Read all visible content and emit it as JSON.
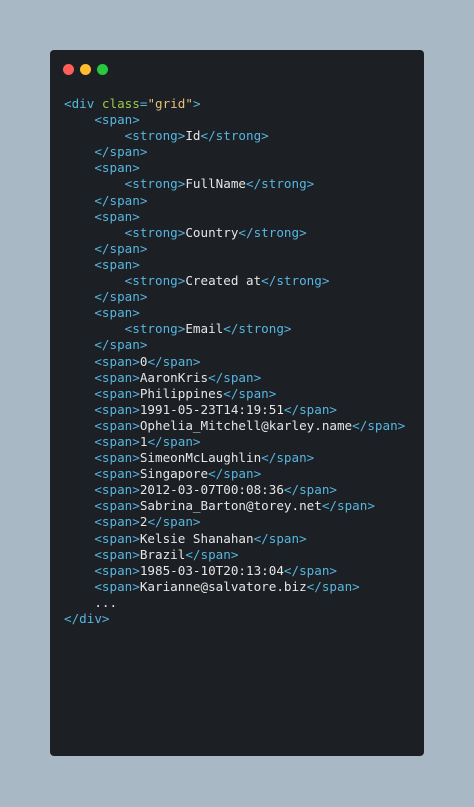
{
  "window": {
    "controls": [
      "close",
      "minimize",
      "maximize"
    ],
    "colors": {
      "close": "#ff5f56",
      "minimize": "#ffbd2e",
      "maximize": "#27c93f",
      "background": "#1c1f23",
      "page": "#a9b8c5"
    }
  },
  "code": {
    "tag_color": "#56b6e0",
    "attr_color": "#9ec74a",
    "string_color": "#e5c07b",
    "text_color": "#e6e6e6",
    "lines": [
      {
        "indent": 0,
        "parts": [
          [
            "tag",
            "<div "
          ],
          [
            "attr",
            "class"
          ],
          [
            "tag",
            "="
          ],
          [
            "str",
            "\"grid\""
          ],
          [
            "tag",
            ">"
          ]
        ]
      },
      {
        "indent": 1,
        "parts": [
          [
            "tag",
            "<span>"
          ]
        ]
      },
      {
        "indent": 2,
        "parts": [
          [
            "tag",
            "<strong>"
          ],
          [
            "txt",
            "Id"
          ],
          [
            "tag",
            "</strong>"
          ]
        ]
      },
      {
        "indent": 1,
        "parts": [
          [
            "tag",
            "</span>"
          ]
        ]
      },
      {
        "indent": 1,
        "parts": [
          [
            "tag",
            "<span>"
          ]
        ]
      },
      {
        "indent": 2,
        "parts": [
          [
            "tag",
            "<strong>"
          ],
          [
            "txt",
            "FullName"
          ],
          [
            "tag",
            "</strong>"
          ]
        ]
      },
      {
        "indent": 1,
        "parts": [
          [
            "tag",
            "</span>"
          ]
        ]
      },
      {
        "indent": 1,
        "parts": [
          [
            "tag",
            "<span>"
          ]
        ]
      },
      {
        "indent": 2,
        "parts": [
          [
            "tag",
            "<strong>"
          ],
          [
            "txt",
            "Country"
          ],
          [
            "tag",
            "</strong>"
          ]
        ]
      },
      {
        "indent": 1,
        "parts": [
          [
            "tag",
            "</span>"
          ]
        ]
      },
      {
        "indent": 1,
        "parts": [
          [
            "tag",
            "<span>"
          ]
        ]
      },
      {
        "indent": 2,
        "parts": [
          [
            "tag",
            "<strong>"
          ],
          [
            "txt",
            "Created at"
          ],
          [
            "tag",
            "</strong>"
          ]
        ]
      },
      {
        "indent": 1,
        "parts": [
          [
            "tag",
            "</span>"
          ]
        ]
      },
      {
        "indent": 1,
        "parts": [
          [
            "tag",
            "<span>"
          ]
        ]
      },
      {
        "indent": 2,
        "parts": [
          [
            "tag",
            "<strong>"
          ],
          [
            "txt",
            "Email"
          ],
          [
            "tag",
            "</strong>"
          ]
        ]
      },
      {
        "indent": 1,
        "parts": [
          [
            "tag",
            "</span>"
          ]
        ]
      },
      {
        "indent": 1,
        "parts": [
          [
            "tag",
            "<span>"
          ],
          [
            "txt",
            "0"
          ],
          [
            "tag",
            "</span>"
          ]
        ]
      },
      {
        "indent": 1,
        "parts": [
          [
            "tag",
            "<span>"
          ],
          [
            "txt",
            "AaronKris"
          ],
          [
            "tag",
            "</span>"
          ]
        ]
      },
      {
        "indent": 1,
        "parts": [
          [
            "tag",
            "<span>"
          ],
          [
            "txt",
            "Philippines"
          ],
          [
            "tag",
            "</span>"
          ]
        ]
      },
      {
        "indent": 1,
        "parts": [
          [
            "tag",
            "<span>"
          ],
          [
            "txt",
            "1991-05-23T14:19:51"
          ],
          [
            "tag",
            "</span>"
          ]
        ]
      },
      {
        "indent": 1,
        "parts": [
          [
            "tag",
            "<span>"
          ],
          [
            "txt",
            "Ophelia_Mitchell@karley.name"
          ],
          [
            "tag",
            "</span>"
          ]
        ]
      },
      {
        "indent": 1,
        "parts": [
          [
            "tag",
            "<span>"
          ],
          [
            "txt",
            "1"
          ],
          [
            "tag",
            "</span>"
          ]
        ]
      },
      {
        "indent": 1,
        "parts": [
          [
            "tag",
            "<span>"
          ],
          [
            "txt",
            "SimeonMcLaughlin"
          ],
          [
            "tag",
            "</span>"
          ]
        ]
      },
      {
        "indent": 1,
        "parts": [
          [
            "tag",
            "<span>"
          ],
          [
            "txt",
            "Singapore"
          ],
          [
            "tag",
            "</span>"
          ]
        ]
      },
      {
        "indent": 1,
        "parts": [
          [
            "tag",
            "<span>"
          ],
          [
            "txt",
            "2012-03-07T00:08:36"
          ],
          [
            "tag",
            "</span>"
          ]
        ]
      },
      {
        "indent": 1,
        "parts": [
          [
            "tag",
            "<span>"
          ],
          [
            "txt",
            "Sabrina_Barton@torey.net"
          ],
          [
            "tag",
            "</span>"
          ]
        ]
      },
      {
        "indent": 1,
        "parts": [
          [
            "tag",
            "<span>"
          ],
          [
            "txt",
            "2"
          ],
          [
            "tag",
            "</span>"
          ]
        ]
      },
      {
        "indent": 1,
        "parts": [
          [
            "tag",
            "<span>"
          ],
          [
            "txt",
            "Kelsie Shanahan"
          ],
          [
            "tag",
            "</span>"
          ]
        ]
      },
      {
        "indent": 1,
        "parts": [
          [
            "tag",
            "<span>"
          ],
          [
            "txt",
            "Brazil"
          ],
          [
            "tag",
            "</span>"
          ]
        ]
      },
      {
        "indent": 1,
        "parts": [
          [
            "tag",
            "<span>"
          ],
          [
            "txt",
            "1985-03-10T20:13:04"
          ],
          [
            "tag",
            "</span>"
          ]
        ]
      },
      {
        "indent": 1,
        "parts": [
          [
            "tag",
            "<span>"
          ],
          [
            "txt",
            "Karianne@salvatore.biz"
          ],
          [
            "tag",
            "</span>"
          ]
        ]
      },
      {
        "indent": 1,
        "parts": [
          [
            "txt",
            "..."
          ]
        ]
      },
      {
        "indent": 0,
        "parts": [
          [
            "tag",
            "</div>"
          ]
        ]
      }
    ]
  }
}
